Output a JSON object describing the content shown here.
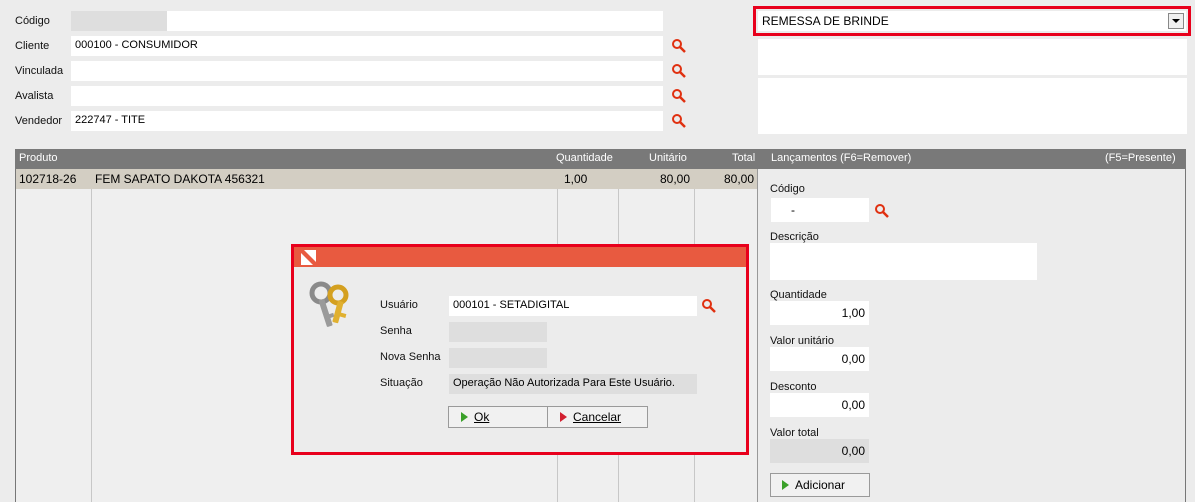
{
  "form": {
    "codigo_label": "Código",
    "cliente_label": "Cliente",
    "cliente_value": "000100 - CONSUMIDOR",
    "vinculada_label": "Vinculada",
    "avalista_label": "Avalista",
    "vendedor_label": "Vendedor",
    "vendedor_value": "222747 - TITE",
    "operacao_value": "REMESSA DE BRINDE"
  },
  "grid": {
    "columns": [
      "Produto",
      "Quantidade",
      "Unitário",
      "Total"
    ],
    "rows": [
      {
        "codigo": "102718-26",
        "descricao": "FEM SAPATO DAKOTA 456321",
        "quantidade": "1,00",
        "unitario": "80,00",
        "total": "80,00"
      }
    ]
  },
  "lancamentos": {
    "title": "Lançamentos (F6=Remover)",
    "presente": "(F5=Presente)",
    "codigo_label": "Código",
    "codigo_value": "-",
    "descricao_label": "Descrição",
    "quantidade_label": "Quantidade",
    "quantidade_value": "1,00",
    "valor_unitario_label": "Valor unitário",
    "valor_unitario_value": "0,00",
    "desconto_label": "Desconto",
    "desconto_value": "0,00",
    "valor_total_label": "Valor total",
    "valor_total_value": "0,00",
    "adicionar_label": "Adicionar"
  },
  "dialog": {
    "usuario_label": "Usuário",
    "usuario_value": "000101 - SETADIGITAL",
    "senha_label": "Senha",
    "nova_senha_label": "Nova Senha",
    "situacao_label": "Situação",
    "situacao_value": "Operação Não Autorizada Para Este Usuário.",
    "ok_label": "Ok",
    "cancelar_label": "Cancelar"
  },
  "colors": {
    "highlight_border": "#e8001c",
    "dialog_title": "#e85a40",
    "grid_header": "#797979",
    "row_selected": "#d3cec3",
    "search_icon": "#e03010"
  },
  "icons": [
    "search-icon",
    "dropdown-arrow-icon",
    "keys-icon",
    "app-logo-icon",
    "green-triangle-icon",
    "red-triangle-icon"
  ]
}
